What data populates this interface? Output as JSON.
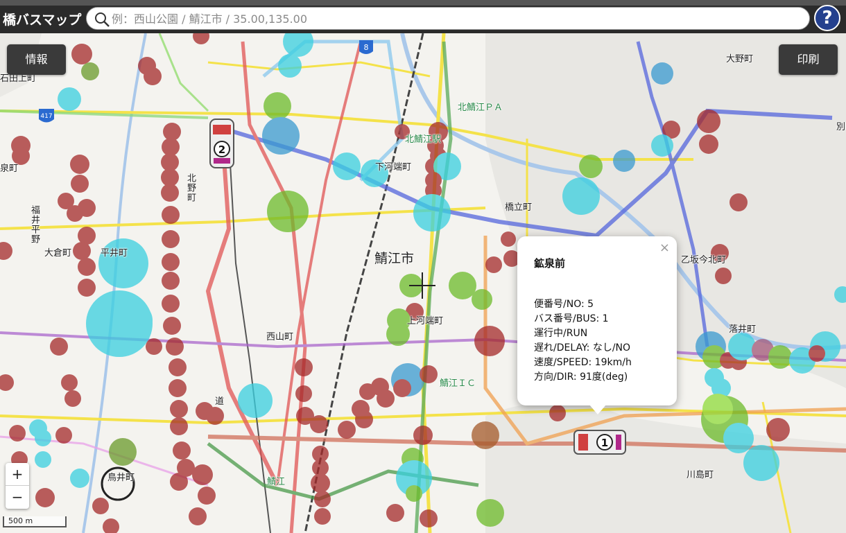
{
  "header": {
    "app_title": "橋バスマップ",
    "search_placeholder": "例：西山公園 / 鯖江市 / 35.00,135.00",
    "help_label": "?"
  },
  "buttons": {
    "info_label": "情報",
    "print_label": "印刷",
    "zoom_in_label": "+",
    "zoom_out_label": "−"
  },
  "scale_label": "500 m",
  "places": {
    "ishida": "石田上町",
    "ohno": "大野町",
    "kitasabae_pa": "北鯖江ＰＡ",
    "kitasabae_st": "北鯖江駅",
    "shimokawabata": "下河端町",
    "izumi": "泉町",
    "kitano": "北野町",
    "fukui_hirano": "福井平野",
    "tachimachi": "橋立町",
    "okura": "大倉町",
    "hirai": "平井町",
    "sabae_city": "鯖江市",
    "kamikawabata": "上河端町",
    "otsusaka": "乙坂今北町",
    "ochii": "落井町",
    "nishiyama": "西山町",
    "sabae_ic": "鯖江ＩＣ",
    "michi": "道",
    "torii": "鳥井町",
    "sabae_st": "鯖江",
    "kawashima": "川島町",
    "betsu": "別",
    "route_8": "8",
    "route_417": "417"
  },
  "popup": {
    "close": "×",
    "title": "鉱泉前",
    "lines": [
      "便番号/NO: 5",
      "バス番号/BUS: 1",
      "運行中/RUN",
      "遅れ/DELAY: なし/NO",
      "速度/SPEED: 19km/h",
      "方向/DIR: 91度(deg)"
    ]
  },
  "bus_markers": [
    {
      "number": "2"
    },
    {
      "number": "1"
    }
  ],
  "colors": {
    "dark_red": "#a52a2a",
    "cyan": "#3ad0e0",
    "green": "#6dbb2a",
    "blue_route": "#5566dd",
    "red_route": "#e05555",
    "orange_route": "#f0a050",
    "header_bg": "#2b2b2b",
    "help_bg": "#24408e"
  }
}
